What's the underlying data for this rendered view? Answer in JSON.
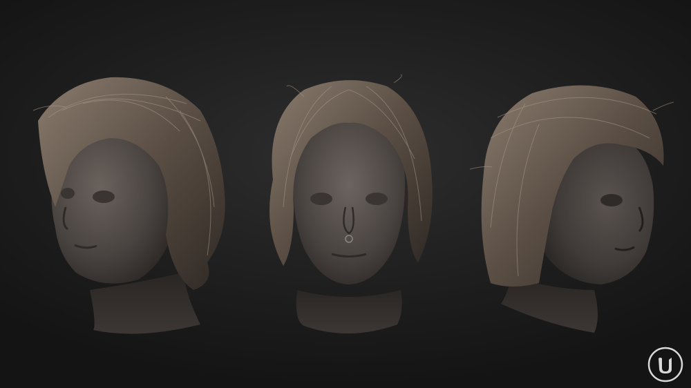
{
  "scene": {
    "background_color": "#1f1f1f",
    "hair_color": "#5a4e44",
    "hair_highlight_color": "#9c8c7c",
    "skin_color": "#4d4744",
    "views": [
      {
        "view": "three-quarter-left"
      },
      {
        "view": "front"
      },
      {
        "view": "three-quarter-right"
      }
    ]
  },
  "watermark": {
    "icon": "unreal-engine-logo-icon",
    "color": "#d9d9d9"
  }
}
